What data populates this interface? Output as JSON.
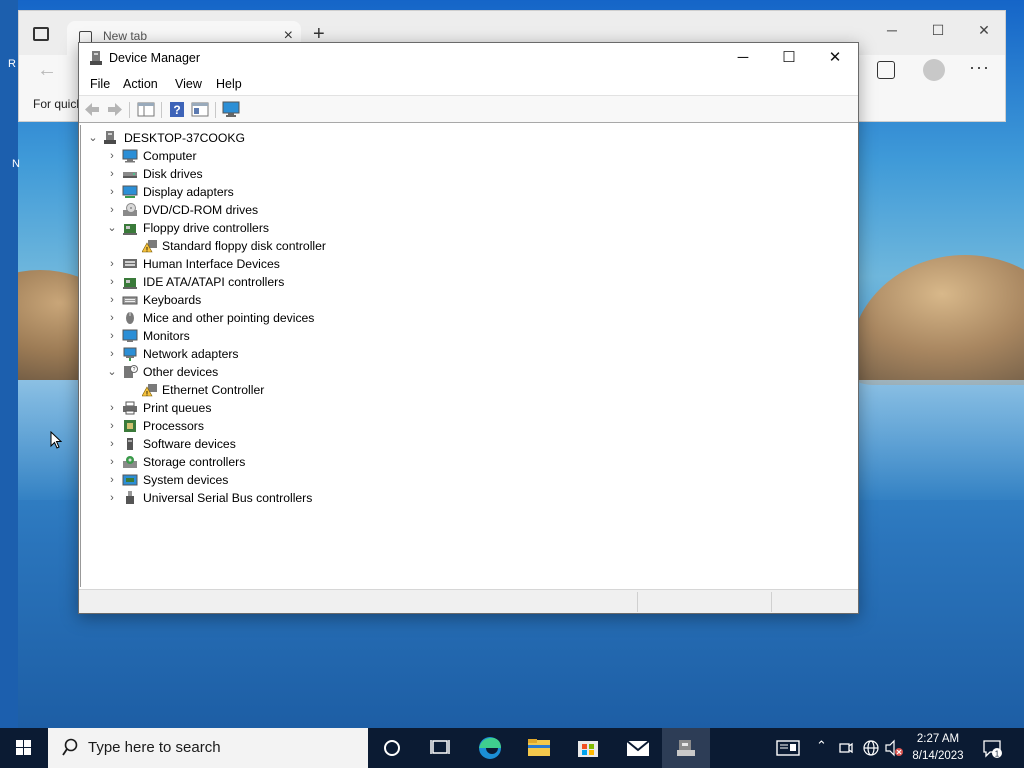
{
  "desktop": {
    "left_fragments": [
      "R",
      "N"
    ]
  },
  "browser": {
    "tab_title": "New tab",
    "new_tab_label": "+",
    "quick_links_text": "For quick"
  },
  "window": {
    "title": "Device Manager",
    "menu": [
      "File",
      "Action",
      "View",
      "Help"
    ],
    "root": "DESKTOP-37COOKG",
    "categories": [
      {
        "label": "Computer",
        "expanded": false,
        "icon": "computer-icon"
      },
      {
        "label": "Disk drives",
        "expanded": false,
        "icon": "disk-drive-icon"
      },
      {
        "label": "Display adapters",
        "expanded": false,
        "icon": "display-adapter-icon"
      },
      {
        "label": "DVD/CD-ROM drives",
        "expanded": false,
        "icon": "dvd-icon"
      },
      {
        "label": "Floppy drive controllers",
        "expanded": true,
        "icon": "controller-icon",
        "children": [
          {
            "label": "Standard floppy disk controller",
            "icon": "warning-device-icon"
          }
        ]
      },
      {
        "label": "Human Interface Devices",
        "expanded": false,
        "icon": "hid-icon"
      },
      {
        "label": "IDE ATA/ATAPI controllers",
        "expanded": false,
        "icon": "controller-icon"
      },
      {
        "label": "Keyboards",
        "expanded": false,
        "icon": "keyboard-icon"
      },
      {
        "label": "Mice and other pointing devices",
        "expanded": false,
        "icon": "mouse-icon"
      },
      {
        "label": "Monitors",
        "expanded": false,
        "icon": "monitor-icon"
      },
      {
        "label": "Network adapters",
        "expanded": false,
        "icon": "network-icon"
      },
      {
        "label": "Other devices",
        "expanded": true,
        "icon": "unknown-device-icon",
        "children": [
          {
            "label": "Ethernet Controller",
            "icon": "warning-device-icon"
          }
        ]
      },
      {
        "label": "Print queues",
        "expanded": false,
        "icon": "printer-icon"
      },
      {
        "label": "Processors",
        "expanded": false,
        "icon": "processor-icon"
      },
      {
        "label": "Software devices",
        "expanded": false,
        "icon": "software-device-icon"
      },
      {
        "label": "Storage controllers",
        "expanded": false,
        "icon": "storage-icon"
      },
      {
        "label": "System devices",
        "expanded": false,
        "icon": "system-device-icon"
      },
      {
        "label": "Universal Serial Bus controllers",
        "expanded": false,
        "icon": "usb-icon"
      }
    ]
  },
  "taskbar": {
    "search_placeholder": "Type here to search",
    "time": "2:27 AM",
    "date": "8/14/2023",
    "notification_count": "1"
  }
}
